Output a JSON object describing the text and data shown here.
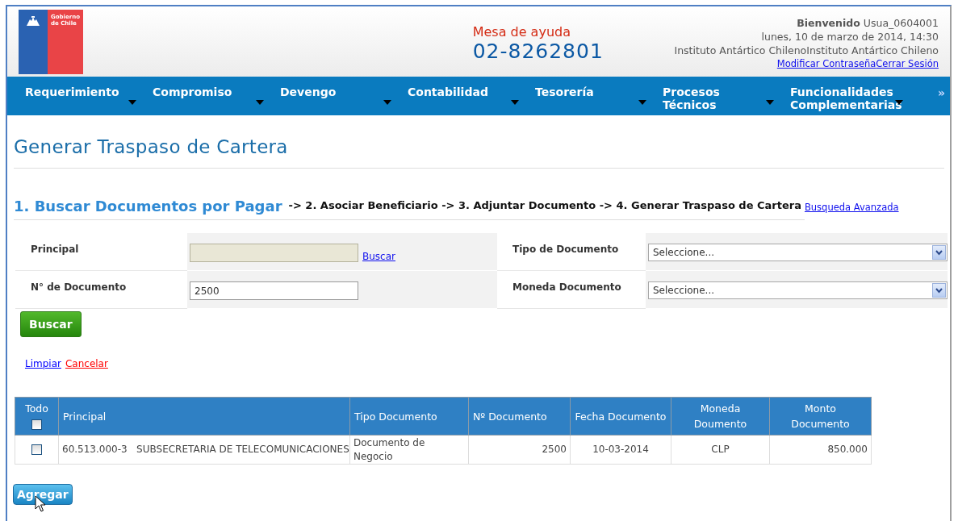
{
  "header": {
    "logo_lines": [
      "Gobierno",
      "de Chile"
    ],
    "helpdesk_label": "Mesa de ayuda",
    "helpdesk_phone": "02-8262801",
    "welcome_label": "Bienvenido",
    "user": "Usua_0604001",
    "datetime": "lunes, 10 de marzo de 2014, 14:30",
    "institution": "Instituto Antártico ChilenoInstituto Antártico Chileno",
    "links": [
      "Modificar Contraseña",
      "Cerrar Sesión"
    ]
  },
  "nav": {
    "items": [
      {
        "label": "Requerimiento"
      },
      {
        "label": "Compromiso"
      },
      {
        "label": "Devengo"
      },
      {
        "label": "Contabilidad"
      },
      {
        "label": "Tesorería"
      },
      {
        "label": "Procesos Técnicos"
      },
      {
        "label": "Funcionalidades Complementarias"
      }
    ],
    "more": "»"
  },
  "page_title": "Generar Traspaso de Cartera",
  "steps": {
    "current": "1. Buscar Documentos por Pagar",
    "rest": "-> 2. Asociar Beneficiario -> 3. Adjuntar Documento -> 4. Generar Traspaso de Cartera",
    "advanced_link": "Busqueda Avanzada"
  },
  "form": {
    "fields": [
      {
        "label": "Principal",
        "kind": "text",
        "readonly": true,
        "link": "Buscar"
      },
      {
        "label": "Tipo de Documento",
        "kind": "select",
        "value": "Seleccione..."
      },
      {
        "label": "N° de Documento",
        "kind": "text",
        "readonly": false,
        "value": "2500"
      },
      {
        "label": "Moneda Documento",
        "kind": "select",
        "value": "Seleccione..."
      }
    ],
    "search_button": "Buscar",
    "links": [
      {
        "label": "Limpiar",
        "color": "#0000ff"
      },
      {
        "label": "Cancelar",
        "color": "#ff0000"
      }
    ]
  },
  "table": {
    "select_all": {
      "label": "Todo",
      "checked": false
    },
    "columns": [
      "Principal",
      "Tipo Documento",
      "Nº Documento",
      "Fecha Documento",
      "Moneda Doumento",
      "Monto Documento"
    ],
    "rows": [
      {
        "checked": false,
        "cells": [
          "60.513.000-3   SUBSECRETARIA DE TELECOMUNICACIONES",
          "Documento de Negocio",
          "2500",
          "10-03-2014",
          "CLP",
          "850.000"
        ]
      }
    ]
  },
  "add_button": "Agregar"
}
